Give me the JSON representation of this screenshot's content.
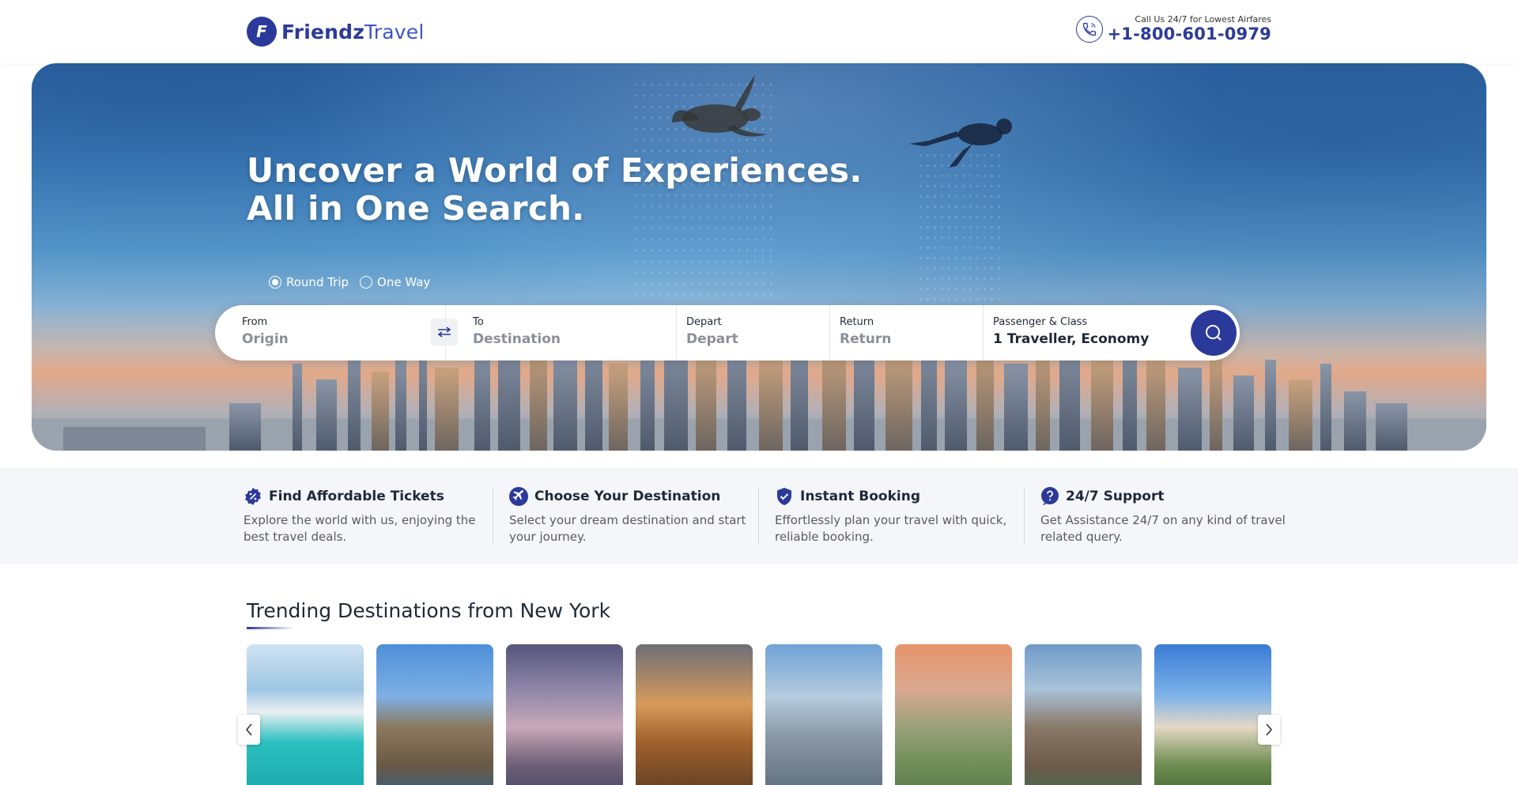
{
  "header": {
    "logo_brand": "Friendz",
    "logo_suffix": "Travel",
    "call_label": "Call Us 24/7 for Lowest Airfares",
    "call_number": "+1-800-601-0979"
  },
  "hero": {
    "title_line1": "Uncover a World of Experiences.",
    "title_line2": "All in One Search."
  },
  "trip_type": {
    "options": [
      "Round Trip",
      "One Way"
    ],
    "selected": "Round Trip"
  },
  "search": {
    "from_label": "From",
    "from_value": "Origin",
    "to_label": "To",
    "to_value": "Destination",
    "depart_label": "Depart",
    "depart_value": "Depart",
    "return_label": "Return",
    "return_value": "Return",
    "pax_label": "Passenger & Class",
    "pax_value": "1 Traveller, Economy"
  },
  "features": [
    {
      "title": "Find Affordable Tickets",
      "desc": "Explore the world with us, enjoying the best travel deals.",
      "icon": "percent-badge-icon"
    },
    {
      "title": "Choose Your Destination",
      "desc": "Select your dream destination and start your journey.",
      "icon": "plane-icon"
    },
    {
      "title": "Instant Booking",
      "desc": "Effortlessly plan your travel with quick, reliable booking.",
      "icon": "shield-check-icon"
    },
    {
      "title": "24/7 Support",
      "desc": "Get Assistance 24/7 on any kind of travel related query.",
      "icon": "question-icon"
    }
  ],
  "trending": {
    "title": "Trending Destinations from New York"
  },
  "colors": {
    "brand": "#2b3a9a",
    "accent": "#3d55c4"
  }
}
